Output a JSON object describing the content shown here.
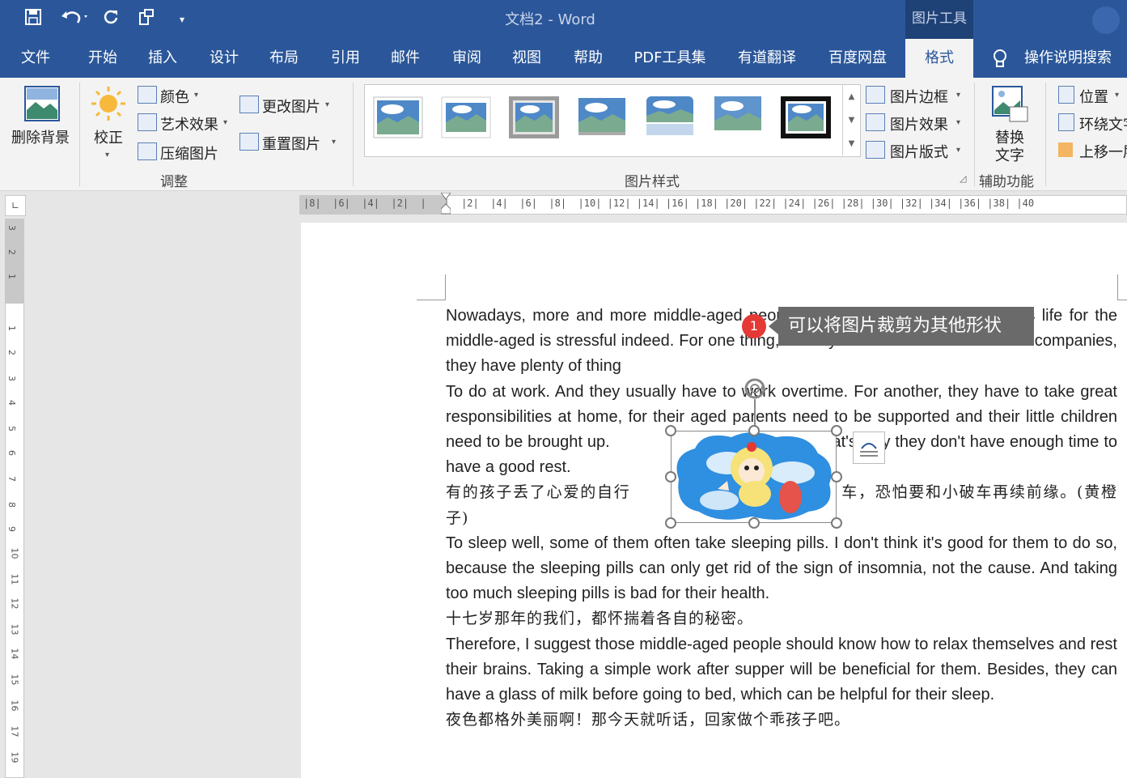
{
  "window": {
    "doc_name": "文档2",
    "separator": "-",
    "app_name": "Word",
    "context_tab_group": "图片工具"
  },
  "qat": {
    "icons": [
      "save-icon",
      "undo-icon",
      "redo-icon",
      "format-painter-icon",
      "customize-qat-icon"
    ]
  },
  "tabs": [
    "文件",
    "开始",
    "插入",
    "设计",
    "布局",
    "引用",
    "邮件",
    "审阅",
    "视图",
    "帮助",
    "PDF工具集",
    "有道翻译",
    "百度网盘",
    "格式",
    "操作说明搜索"
  ],
  "active_tab": "格式",
  "ribbon": {
    "adjust": {
      "remove_bg": "删除背景",
      "corrections": "校正",
      "color": "颜色",
      "artistic": "艺术效果",
      "compress": "压缩图片",
      "change": "更改图片",
      "reset": "重置图片",
      "group_label": "调整"
    },
    "styles": {
      "border": "图片边框",
      "effects": "图片效果",
      "layout": "图片版式",
      "group_label": "图片样式"
    },
    "accessibility": {
      "alt_text_line1": "替换",
      "alt_text_line2": "文字",
      "group_label": "辅助功能"
    },
    "arrange": {
      "position": "位置",
      "wrap": "环绕文字",
      "bring_forward": "上移一层"
    }
  },
  "ruler": {
    "top": "|8|  |6|  |4|  |2|  |   |  |2|  |4|  |6|  |8|  |10| |12| |14| |16| |18| |20| |22| |24| |26| |28| |30| |32| |34| |36| |38| |40",
    "left_numbers": [
      "3",
      "2",
      "1",
      "1",
      "2",
      "3",
      "4",
      "5",
      "6",
      "7",
      "8",
      "9",
      "10",
      "11",
      "12",
      "13",
      "14",
      "15",
      "16",
      "17",
      "19"
    ]
  },
  "document": {
    "p1": "Nowadays, more and more middle-aged people are suffering from insomnia, as life for the middle-aged is stressful indeed. For one thing, as they are the backbones of their companies, they have plenty of thing",
    "p2a": "To do at work. And they usually have to work overtime. For another, they have to take great responsibilities at home, for their aged parents need to be supported and their little children need to be brought up.",
    "p2b": "That's why they don't have enough time to have a good rest.",
    "p3a": "有的孩子丢了心爱的自行",
    "p3b": "车，恐怕要和小破车再续前缘。(黄橙子)",
    "p4": "To sleep well, some of them often take sleeping pills. I don't think it's good for them to do so, because the sleeping pills can only get rid of the sign of insomnia, not the cause. And taking too much sleeping pills is bad for their health.",
    "p5": "十七岁那年的我们，都怀揣着各自的秘密。",
    "p6": "Therefore, I suggest those middle-aged people should know how to relax themselves and rest their brains. Taking a simple work after supper will be beneficial for them. Besides, they can have a glass of milk before going to bed, which can be helpful for their sleep.",
    "p7": "夜色都格外美丽啊！那今天就听话，回家做个乖孩子吧。"
  },
  "tooltip": {
    "badge": "1",
    "text": "可以将图片裁剪为其他形状"
  },
  "colors": {
    "brand": "#2b579a",
    "ribbon": "#f3f3f3",
    "badge": "#e53935"
  }
}
